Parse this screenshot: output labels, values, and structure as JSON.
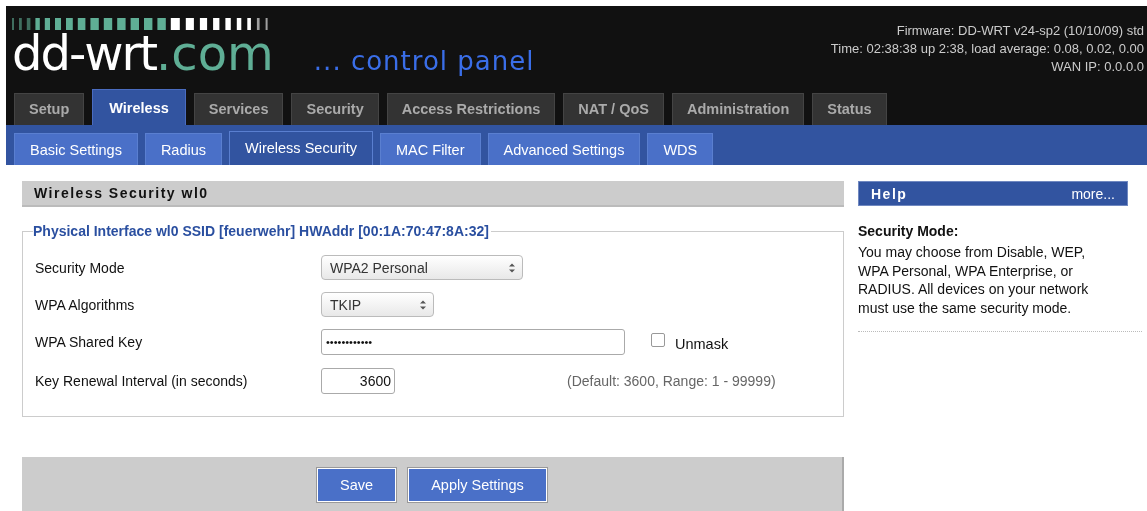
{
  "header": {
    "logo": {
      "name": "dd-wrt",
      "suffix": ".com"
    },
    "subtitle": "... control panel",
    "firmware": "Firmware: DD-WRT v24-sp2 (10/10/09) std",
    "time": "Time: 02:38:38 up 2:38, load average: 0.08, 0.02, 0.00",
    "wan_ip": "WAN IP: 0.0.0.0"
  },
  "tabs": [
    {
      "label": "Setup",
      "selected": false
    },
    {
      "label": "Wireless",
      "selected": true
    },
    {
      "label": "Services",
      "selected": false
    },
    {
      "label": "Security",
      "selected": false
    },
    {
      "label": "Access Restrictions",
      "selected": false
    },
    {
      "label": "NAT / QoS",
      "selected": false
    },
    {
      "label": "Administration",
      "selected": false
    },
    {
      "label": "Status",
      "selected": false
    }
  ],
  "subtabs": [
    {
      "label": "Basic Settings",
      "selected": false
    },
    {
      "label": "Radius",
      "selected": false
    },
    {
      "label": "Wireless Security",
      "selected": true
    },
    {
      "label": "MAC Filter",
      "selected": false
    },
    {
      "label": "Advanced Settings",
      "selected": false
    },
    {
      "label": "WDS",
      "selected": false
    }
  ],
  "section": {
    "title": "Wireless Security wl0",
    "legend": "Physical Interface wl0 SSID [feuerwehr] HWAddr [00:1A:70:47:8A:32]",
    "rows": [
      {
        "kind": "select",
        "label": "Security Mode",
        "value": "WPA2 Personal"
      },
      {
        "kind": "select-small",
        "label": "WPA Algorithms",
        "value": "TKIP"
      },
      {
        "kind": "password",
        "label": "WPA Shared Key",
        "value": "••••••••••••",
        "checkbox": {
          "label": "Unmask",
          "checked": false
        }
      },
      {
        "kind": "number",
        "label": "Key Renewal Interval (in seconds)",
        "value": "3600",
        "hint": "(Default: 3600, Range: 1 - 99999)"
      }
    ]
  },
  "buttons": [
    "Save",
    "Apply Settings"
  ],
  "help": {
    "title": "Help",
    "more": "more...",
    "heading": "Security Mode:",
    "text": "You may choose from Disable, WEP, WPA Personal, WPA Enterprise, or RADIUS. All devices on your network must use the same security mode."
  }
}
